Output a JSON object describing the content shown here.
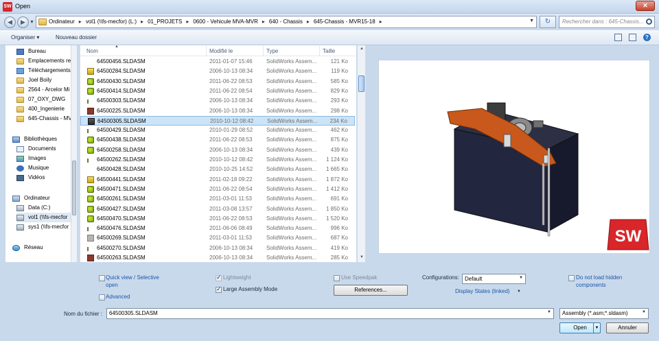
{
  "window": {
    "title": "Open",
    "app_icon": "SW",
    "close": "✕"
  },
  "address": {
    "crumbs": [
      "Ordinateur",
      "vol1 (\\\\fs-mecfor) (L:)",
      "01_PROJETS",
      "0600 - Vehicule MVA-MVR",
      "640 - Chassis",
      "645-Chassis - MVR15-18"
    ],
    "search_placeholder": "Rechercher dans : 645-Chassis..."
  },
  "toolbar": {
    "organize": "Organiser ▾",
    "new_folder": "Nouveau dossier"
  },
  "nav": {
    "items": [
      {
        "label": "Bureau",
        "icon": "desktop-icon"
      },
      {
        "label": "Emplacements re",
        "icon": "recent-places-icon"
      },
      {
        "label": "Téléchargements",
        "icon": "downloads-icon"
      },
      {
        "label": "Joel Boily",
        "icon": "folder-icon"
      },
      {
        "label": "2564 - Arcelor Mi",
        "icon": "folder-icon"
      },
      {
        "label": "07_OXY_DWG",
        "icon": "folder-icon"
      },
      {
        "label": "400_Ingenierie",
        "icon": "folder-icon"
      },
      {
        "label": "645-Chassis - MV",
        "icon": "folder-icon"
      },
      {
        "label": "Bibliothèques",
        "icon": "libraries-icon"
      },
      {
        "label": "Documents",
        "icon": "documents-icon"
      },
      {
        "label": "Images",
        "icon": "images-icon"
      },
      {
        "label": "Musique",
        "icon": "music-icon"
      },
      {
        "label": "Vidéos",
        "icon": "videos-icon"
      },
      {
        "label": "Ordinateur",
        "icon": "computer-icon"
      },
      {
        "label": "Data (C:)",
        "icon": "drive-icon"
      },
      {
        "label": "vol1 (\\\\fs-mecfor",
        "icon": "network-drive-icon"
      },
      {
        "label": "sys1 (\\\\fs-mecfor",
        "icon": "network-drive-icon"
      },
      {
        "label": "Réseau",
        "icon": "network-icon"
      }
    ]
  },
  "columns": {
    "name": "Nom",
    "modified": "Modifié le",
    "type": "Type",
    "size": "Taille",
    "sort_indicator": "▲"
  },
  "files": [
    {
      "name": "64500456.SLDASM",
      "date": "2011-01-07 15:46",
      "type": "SolidWorks Assem...",
      "size": "121 Ko",
      "icon": "blank"
    },
    {
      "name": "64500284.SLDASM",
      "date": "2006-10-13 08:34",
      "type": "SolidWorks Assem...",
      "size": "119 Ko",
      "icon": "yellow"
    },
    {
      "name": "64500430.SLDASM",
      "date": "2011-06-22 08:53",
      "type": "SolidWorks Assem...",
      "size": "585 Ko",
      "icon": "green"
    },
    {
      "name": "64500414.SLDASM",
      "date": "2011-06-22 08:54",
      "type": "SolidWorks Assem...",
      "size": "829 Ko",
      "icon": "green"
    },
    {
      "name": "64500303.SLDASM",
      "date": "2006-10-13 08:34",
      "type": "SolidWorks Assem...",
      "size": "293 Ko",
      "icon": "small"
    },
    {
      "name": "64500225.SLDASM",
      "date": "2006-10-13 08:34",
      "type": "SolidWorks Assem...",
      "size": "298 Ko",
      "icon": "brown"
    },
    {
      "name": "64500305.SLDASM",
      "date": "2010-10-12 08:42",
      "type": "SolidWorks Assem...",
      "size": "234 Ko",
      "icon": "dark",
      "selected": true
    },
    {
      "name": "64500429.SLDASM",
      "date": "2010-01-29 08:52",
      "type": "SolidWorks Assem...",
      "size": "462 Ko",
      "icon": "small"
    },
    {
      "name": "64500438.SLDASM",
      "date": "2011-06-22 08:53",
      "type": "SolidWorks Assem...",
      "size": "875 Ko",
      "icon": "green"
    },
    {
      "name": "64500258.SLDASM",
      "date": "2006-10-13 08:34",
      "type": "SolidWorks Assem...",
      "size": "439 Ko",
      "icon": "green"
    },
    {
      "name": "64500262.SLDASM",
      "date": "2010-10-12 08:42",
      "type": "SolidWorks Assem...",
      "size": "1 124 Ko",
      "icon": "small"
    },
    {
      "name": "64500428.SLDASM",
      "date": "2010-10-25 14:52",
      "type": "SolidWorks Assem...",
      "size": "1 665 Ko",
      "icon": "blank"
    },
    {
      "name": "64500441.SLDASM",
      "date": "2011-02-18 09:22",
      "type": "SolidWorks Assem...",
      "size": "1 872 Ko",
      "icon": "yellow"
    },
    {
      "name": "64500471.SLDASM",
      "date": "2011-06-22 08:54",
      "type": "SolidWorks Assem...",
      "size": "1 412 Ko",
      "icon": "green"
    },
    {
      "name": "64500261.SLDASM",
      "date": "2011-03-01 11:53",
      "type": "SolidWorks Assem...",
      "size": "691 Ko",
      "icon": "green"
    },
    {
      "name": "64500427.SLDASM",
      "date": "2011-03-08 13:57",
      "type": "SolidWorks Assem...",
      "size": "1 850 Ko",
      "icon": "green"
    },
    {
      "name": "64500470.SLDASM",
      "date": "2011-06-22 08:53",
      "type": "SolidWorks Assem...",
      "size": "1 520 Ko",
      "icon": "green"
    },
    {
      "name": "64500476.SLDASM",
      "date": "2011-06-06 08:49",
      "type": "SolidWorks Assem...",
      "size": "996 Ko",
      "icon": "small"
    },
    {
      "name": "64500269.SLDASM",
      "date": "2011-03-01 11:53",
      "type": "SolidWorks Assem...",
      "size": "687 Ko",
      "icon": "gray"
    },
    {
      "name": "64500270.SLDASM",
      "date": "2006-10-13 08:34",
      "type": "SolidWorks Assem...",
      "size": "419 Ko",
      "icon": "small"
    },
    {
      "name": "64500263.SLDASM",
      "date": "2006-10-13 08:34",
      "type": "SolidWorks Assem...",
      "size": "285 Ko",
      "icon": "brown"
    }
  ],
  "options": {
    "quick_view": "Quick view / Selective",
    "quick_view_2": "open",
    "advanced": "Advanced",
    "lightweight": "Lightweight",
    "large_assembly": "Large Assembly Mode",
    "speedpak": "Use Speedpak",
    "references": "References...",
    "configurations_label": "Configurations:",
    "configurations_value": "Default",
    "display_states": "Display States (linked)",
    "no_load_hidden": "Do not load hidden",
    "no_load_hidden_2": "components"
  },
  "bottom": {
    "filename_label": "Nom du fichier :",
    "filename_value": "64500305.SLDASM",
    "filetype_value": "Assembly (*.asm;*.sldasm)",
    "open": "Open",
    "cancel": "Annuler"
  },
  "colors": {
    "accent": "#1a56a8",
    "selection": "#cce4f7",
    "sw_red": "#d8262a"
  }
}
